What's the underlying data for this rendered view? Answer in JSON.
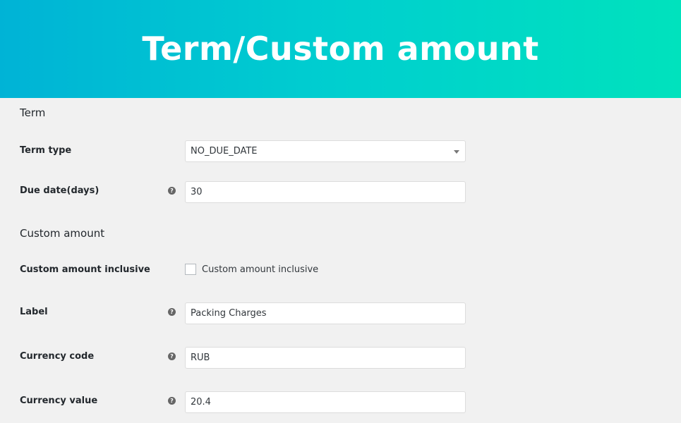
{
  "header": {
    "title": "Term/Custom amount"
  },
  "term_section": {
    "heading": "Term",
    "term_type": {
      "label": "Term type",
      "selected": "NO_DUE_DATE"
    },
    "due_date": {
      "label": "Due date(days)",
      "value": "30",
      "help_icon": "question-mark"
    }
  },
  "custom_amount_section": {
    "heading": "Custom amount",
    "inclusive": {
      "label": "Custom amount inclusive",
      "checkbox_label": "Custom amount inclusive",
      "checked": false
    },
    "label_field": {
      "label": "Label",
      "value": "Packing Charges",
      "help_icon": "question-mark"
    },
    "currency_code": {
      "label": "Currency code",
      "value": "RUB",
      "help_icon": "question-mark"
    },
    "currency_value": {
      "label": "Currency value",
      "value": "20.4",
      "help_icon": "question-mark"
    }
  },
  "colors": {
    "banner_start": "#00b3d6",
    "banner_end": "#00e2bd",
    "background": "#f1f1f1"
  }
}
